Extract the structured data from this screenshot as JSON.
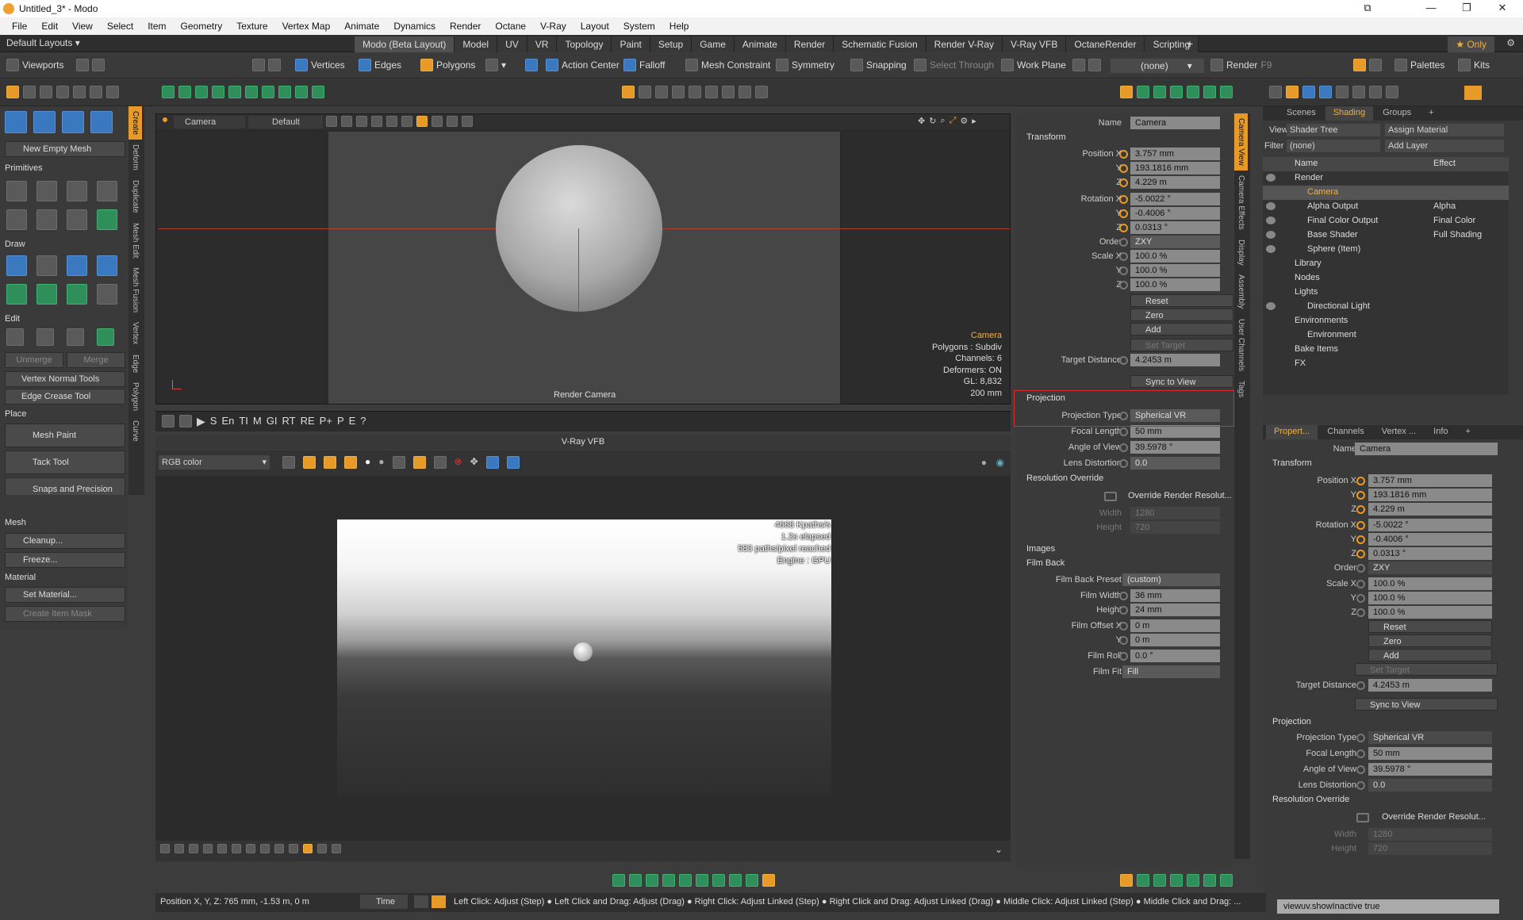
{
  "window": {
    "title": "Untitled_3* - Modo",
    "controls": [
      "⧉",
      "—",
      "❐",
      "✕"
    ]
  },
  "menu": [
    "File",
    "Edit",
    "View",
    "Select",
    "Item",
    "Geometry",
    "Texture",
    "Vertex Map",
    "Animate",
    "Dynamics",
    "Render",
    "Octane",
    "V-Ray",
    "Layout",
    "System",
    "Help"
  ],
  "layout_dropdown": "Default Layouts ▾",
  "layout_tabs": [
    "Modo (Beta Layout)",
    "Model",
    "UV",
    "VR",
    "Topology",
    "Paint",
    "Setup",
    "Game",
    "Animate",
    "Render",
    "Schematic Fusion",
    "Render V-Ray",
    "V-Ray VFB",
    "OctaneRender",
    "Scripting"
  ],
  "layout_add": "+",
  "only_label": "★ Only",
  "toolbar2": {
    "viewports": "Viewports",
    "vertices": "Vertices",
    "edges": "Edges",
    "polygons": "Polygons",
    "action_center": "Action Center",
    "falloff": "Falloff",
    "mesh_constraint": "Mesh Constraint",
    "symmetry": "Symmetry",
    "snapping": "Snapping",
    "select_through": "Select Through",
    "work_plane": "Work Plane",
    "none_dd": "(none)",
    "render": "Render",
    "render_key": "F9",
    "palettes": "Palettes",
    "kits": "Kits"
  },
  "left_panel": {
    "new_empty_mesh": "New Empty Mesh",
    "primitives": "Primitives",
    "draw": "Draw",
    "edit": "Edit",
    "unmerge": "Unmerge",
    "merge": "Merge",
    "vertex_normal": "Vertex Normal Tools",
    "edge_crease": "Edge Crease Tool",
    "place": "Place",
    "mesh_paint": "Mesh Paint",
    "tack_tool": "Tack Tool",
    "snaps": "Snaps and Precision",
    "mesh": "Mesh",
    "cleanup": "Cleanup...",
    "freeze": "Freeze...",
    "material": "Material",
    "set_material": "Set Material...",
    "create_item_mask": "Create Item Mask"
  },
  "left_vtabs": [
    "Create",
    "Deform",
    "Duplicate",
    "Mesh Edit",
    "Mesh Fusion",
    "Vertex",
    "Edge",
    "Polygon",
    "Curve"
  ],
  "viewport": {
    "camera_dd": "Camera",
    "shading_dd": "Default",
    "label": "Render Camera",
    "info": {
      "camera": "Camera",
      "polygons": "Polygons : Subdiv",
      "channels": "Channels: 6",
      "deformers": "Deformers: ON",
      "gl": "GL: 8,832",
      "size": "200 mm"
    }
  },
  "vfb": {
    "title": "V-Ray VFB",
    "channel": "RGB color",
    "stats": [
      "4668 Kpaths/s",
      "1.2s elapsed",
      "583 paths/pixel reached",
      "Engine : GPU"
    ],
    "bar_buttons": [
      "S",
      "En",
      "TI",
      "M",
      "GI",
      "RT",
      "RE",
      "P+",
      "P",
      "E",
      "?"
    ]
  },
  "props": {
    "name_label": "Name",
    "name": "Camera",
    "transform": "Transform",
    "pos_x_label": "Position X",
    "pos_x": "3.757 mm",
    "pos_y": "193.1816 mm",
    "pos_z": "4.229 m",
    "rot_x_label": "Rotation X",
    "rot_x": "-5.0022 °",
    "rot_y": "-0.4006 °",
    "rot_z": "0.0313 °",
    "order_label": "Order",
    "order": "ZXY",
    "scale_x_label": "Scale X",
    "scale_x": "100.0 %",
    "scale_y": "100.0 %",
    "scale_z": "100.0 %",
    "y": "Y",
    "z": "Z",
    "reset": "Reset",
    "zero": "Zero",
    "add": "Add",
    "set_target": "Set Target",
    "target_distance_label": "Target Distance",
    "target_distance": "4.2453 m",
    "sync_to_view": "Sync to View",
    "projection": "Projection",
    "projection_type_label": "Projection Type",
    "projection_type": "Spherical VR",
    "focal_length_label": "Focal Length",
    "focal_length": "50 mm",
    "aov_label": "Angle of View",
    "aov": "39.5978 °",
    "lens_distortion_label": "Lens Distortion",
    "lens_distortion": "0.0",
    "resolution_override": "Resolution Override",
    "override_render": "Override Render Resolut...",
    "width_label": "Width",
    "width": "1280",
    "height_label": "Height",
    "height": "720",
    "images": "Images",
    "film_back": "Film Back",
    "film_back_preset_label": "Film Back Preset",
    "film_back_preset": "(custom)",
    "film_width_label": "Film Width",
    "film_width": "36 mm",
    "film_height": "24 mm",
    "film_offset_x_label": "Film Offset X",
    "film_offset_x": "0 m",
    "film_offset_y": "0 m",
    "film_roll_label": "Film Roll",
    "film_roll": "0.0 °",
    "film_fit_label": "Film Fit",
    "film_fit": "Fill"
  },
  "props_vtabs": [
    "Camera View",
    "Camera Effects",
    "Display",
    "Assembly",
    "User Channels",
    "Tags"
  ],
  "shader": {
    "tabs": [
      "Scenes",
      "Shading",
      "Groups",
      "+"
    ],
    "view_label": "View",
    "view": "Shader Tree",
    "assign_material": "Assign Material",
    "filter_label": "Filter",
    "filter": "(none)",
    "add_layer": "Add Layer",
    "col_name": "Name",
    "col_effect": "Effect",
    "rows": [
      {
        "name": "Render",
        "effect": "",
        "indent": 0
      },
      {
        "name": "Camera",
        "effect": "",
        "indent": 1
      },
      {
        "name": "Alpha Output",
        "effect": "Alpha",
        "indent": 1
      },
      {
        "name": "Final Color Output",
        "effect": "Final Color",
        "indent": 1
      },
      {
        "name": "Base Shader",
        "effect": "Full Shading",
        "indent": 1
      },
      {
        "name": "Sphere (Item)",
        "effect": "",
        "indent": 1
      },
      {
        "name": "Library",
        "effect": "",
        "indent": 0
      },
      {
        "name": "Nodes",
        "effect": "",
        "indent": 0
      },
      {
        "name": "Lights",
        "effect": "",
        "indent": 0
      },
      {
        "name": "Directional Light",
        "effect": "",
        "indent": 1
      },
      {
        "name": "Environments",
        "effect": "",
        "indent": 0
      },
      {
        "name": "Environment",
        "effect": "",
        "indent": 1
      },
      {
        "name": "Bake Items",
        "effect": "",
        "indent": 0
      },
      {
        "name": "FX",
        "effect": "",
        "indent": 0
      }
    ]
  },
  "props_right_tabs": [
    "Propert...",
    "Channels",
    "Vertex ...",
    "Info",
    "+"
  ],
  "status": {
    "position": "Position X, Y, Z:  765 mm, -1.53 m, 0 m",
    "time": "Time",
    "hints": "Left Click: Adjust (Step) ● Left Click and Drag: Adjust (Drag) ● Right Click: Adjust Linked (Step) ● Right Click and Drag: Adjust Linked (Drag) ● Middle Click: Adjust Linked (Step) ● Middle Click and Drag: ...",
    "command": "viewuv.showInactive true"
  },
  "colors": {
    "accent": "#e89a28",
    "highlight_box": "#d23030"
  }
}
